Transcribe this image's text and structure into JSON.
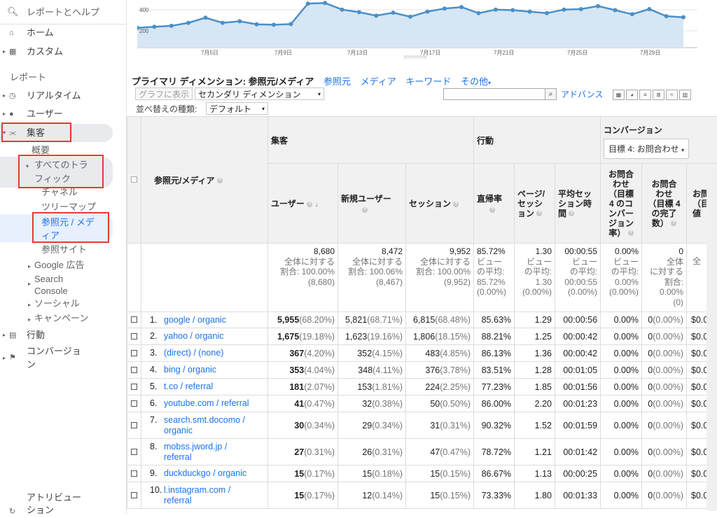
{
  "sidebar": {
    "search_label": "レポートとヘルプ",
    "home": "ホーム",
    "custom": "カスタム",
    "reports_section": "レポート",
    "realtime": "リアルタイム",
    "users": "ユーザー",
    "acquisition": "集客",
    "overview": "概要",
    "all_traffic_1": "すべてのトラ",
    "all_traffic_2": "フィック",
    "channels": "チャネル",
    "treemap": "ツリーマップ",
    "source_medium_1": "参照元 / メデ",
    "source_medium_2": "ィア",
    "referrals": "参照サイト",
    "google_ads": "Google 広告",
    "search_console_1": "Search",
    "search_console_2": "Console",
    "social": "ソーシャル",
    "campaigns": "キャンペーン",
    "behavior": "行動",
    "conversions_1": "コンバージョ",
    "conversions_2": "ン",
    "attribution_1": "アトリビュー",
    "attribution_2": "ション"
  },
  "chart": {
    "y_ticks": [
      "400",
      "200"
    ],
    "x_ticks": [
      "7月5日",
      "7月9日",
      "7月13日",
      "7月17日",
      "7月21日",
      "7月25日",
      "7月29日"
    ],
    "line_color": "#4a90c8",
    "values": [
      195,
      205,
      215,
      245,
      295,
      245,
      260,
      230,
      225,
      232,
      435,
      440,
      375,
      350,
      315,
      345,
      305,
      355,
      385,
      400,
      340,
      375,
      370,
      355,
      340,
      375,
      380,
      410,
      370,
      330,
      380,
      310,
      300
    ]
  },
  "toolbar": {
    "primary_dim_label": "プライマリ ディメンション: 参照元/メディア",
    "dim_source": "参照元",
    "dim_medium": "メディア",
    "dim_keyword": "キーワード",
    "dim_other": "その他",
    "graph_btn": "グラフに表示",
    "secondary_dim": "セカンダリ ディメンション",
    "sort_label": "並べ替えの種類:",
    "sort_value": "デフォルト",
    "advanced": "アドバンス"
  },
  "table": {
    "col_dimension": "参照元/メディア",
    "grp_acquisition": "集客",
    "grp_behavior": "行動",
    "grp_conversion": "コンバージョン",
    "goal_select": "目標 4: お問合わせ",
    "h_users": "ユーザー",
    "h_new_users": "新規ユーザー",
    "h_sessions": "セッション",
    "h_bounce": "直帰率",
    "h_pages_1": "ページ/",
    "h_pages_2": "セッシ",
    "h_pages_3": "ョン",
    "h_duration_1": "平均セッ",
    "h_duration_2": "ション時",
    "h_duration_3": "間",
    "h_conv_rate": [
      "お問合",
      "わせ",
      "（目標",
      "4 のコ",
      "ンバー",
      "ジョン",
      "率）"
    ],
    "h_conv_comp": [
      "お問合",
      "わせ",
      "（目標 4",
      "の完了",
      "数）"
    ],
    "h_value_partial": [
      "お問",
      "（目",
      "値"
    ],
    "totals": {
      "users": "8,680",
      "users_sub": [
        "全体に対する",
        "割合: 100.00%",
        "(8,680)"
      ],
      "new_users": "8,472",
      "new_users_sub": [
        "全体に対する",
        "割合: 100.06%",
        "(8,467)"
      ],
      "sessions": "9,952",
      "sessions_sub": [
        "全体に対する",
        "割合: 100.00%",
        "(9,952)"
      ],
      "bounce": "85.72%",
      "bounce_sub": [
        "ビュー",
        "の平均:",
        "85.72%",
        "(0.00%)"
      ],
      "pages": "1.30",
      "pages_sub": [
        "ビュー",
        "の平均:",
        "1.30",
        "(0.00%)"
      ],
      "duration": "00:00:55",
      "duration_sub": [
        "ビュー",
        "の平均:",
        "00:00:55",
        "(0.00%)"
      ],
      "conv": "0.00%",
      "conv_sub": [
        "ビュー",
        "の平均:",
        "0.00%",
        "(0.00%)"
      ],
      "comp": "0",
      "comp_sub": [
        "全体",
        "に対する",
        "割合:",
        "0.00%",
        "(0)"
      ],
      "value_partial": "全"
    },
    "rows": [
      {
        "n": "1.",
        "src": [
          "google / organic"
        ],
        "u": "5,955",
        "up": "(68.20%)",
        "nu": "5,821",
        "nup": "(68.71%)",
        "s": "6,815",
        "sp": "(68.48%)",
        "b": "85.63%",
        "p": "1.29",
        "d": "00:00:56",
        "cr": "0.00%",
        "cc": "0",
        "ccp": "(0.00%)",
        "v": "$0.0"
      },
      {
        "n": "2.",
        "src": [
          "yahoo / organic"
        ],
        "u": "1,675",
        "up": "(19.18%)",
        "nu": "1,623",
        "nup": "(19.16%)",
        "s": "1,806",
        "sp": "(18.15%)",
        "b": "88.21%",
        "p": "1.25",
        "d": "00:00:42",
        "cr": "0.00%",
        "cc": "0",
        "ccp": "(0.00%)",
        "v": "$0.0"
      },
      {
        "n": "3.",
        "src": [
          "(direct) / (none)"
        ],
        "u": "367",
        "up": "(4.20%)",
        "nu": "352",
        "nup": "(4.15%)",
        "s": "483",
        "sp": "(4.85%)",
        "b": "86.13%",
        "p": "1.36",
        "d": "00:00:42",
        "cr": "0.00%",
        "cc": "0",
        "ccp": "(0.00%)",
        "v": "$0.0"
      },
      {
        "n": "4.",
        "src": [
          "bing / organic"
        ],
        "u": "353",
        "up": "(4.04%)",
        "nu": "348",
        "nup": "(4.11%)",
        "s": "376",
        "sp": "(3.78%)",
        "b": "83.51%",
        "p": "1.28",
        "d": "00:01:05",
        "cr": "0.00%",
        "cc": "0",
        "ccp": "(0.00%)",
        "v": "$0.0"
      },
      {
        "n": "5.",
        "src": [
          "t.co / referral"
        ],
        "u": "181",
        "up": "(2.07%)",
        "nu": "153",
        "nup": "(1.81%)",
        "s": "224",
        "sp": "(2.25%)",
        "b": "77.23%",
        "p": "1.85",
        "d": "00:01:56",
        "cr": "0.00%",
        "cc": "0",
        "ccp": "(0.00%)",
        "v": "$0.0"
      },
      {
        "n": "6.",
        "src": [
          "youtube.com / referral"
        ],
        "u": "41",
        "up": "(0.47%)",
        "nu": "32",
        "nup": "(0.38%)",
        "s": "50",
        "sp": "(0.50%)",
        "b": "86.00%",
        "p": "2.20",
        "d": "00:01:23",
        "cr": "0.00%",
        "cc": "0",
        "ccp": "(0.00%)",
        "v": "$0.0"
      },
      {
        "n": "7.",
        "src": [
          "search.smt.docomo /",
          "organic"
        ],
        "u": "30",
        "up": "(0.34%)",
        "nu": "29",
        "nup": "(0.34%)",
        "s": "31",
        "sp": "(0.31%)",
        "b": "90.32%",
        "p": "1.52",
        "d": "00:01:59",
        "cr": "0.00%",
        "cc": "0",
        "ccp": "(0.00%)",
        "v": "$0.0"
      },
      {
        "n": "8.",
        "src": [
          "mobss.jword.jp /",
          "referral"
        ],
        "u": "27",
        "up": "(0.31%)",
        "nu": "26",
        "nup": "(0.31%)",
        "s": "47",
        "sp": "(0.47%)",
        "b": "78.72%",
        "p": "1.21",
        "d": "00:01:42",
        "cr": "0.00%",
        "cc": "0",
        "ccp": "(0.00%)",
        "v": "$0.0"
      },
      {
        "n": "9.",
        "src": [
          "duckduckgo / organic"
        ],
        "u": "15",
        "up": "(0.17%)",
        "nu": "15",
        "nup": "(0.18%)",
        "s": "15",
        "sp": "(0.15%)",
        "b": "86.67%",
        "p": "1.13",
        "d": "00:00:25",
        "cr": "0.00%",
        "cc": "0",
        "ccp": "(0.00%)",
        "v": "$0.0"
      },
      {
        "n": "10.",
        "src": [
          "l.instagram.com /",
          "referral"
        ],
        "u": "15",
        "up": "(0.17%)",
        "nu": "12",
        "nup": "(0.14%)",
        "s": "15",
        "sp": "(0.15%)",
        "b": "73.33%",
        "p": "1.80",
        "d": "00:01:33",
        "cr": "0.00%",
        "cc": "0",
        "ccp": "(0.00%)",
        "v": "$0.0"
      }
    ]
  }
}
